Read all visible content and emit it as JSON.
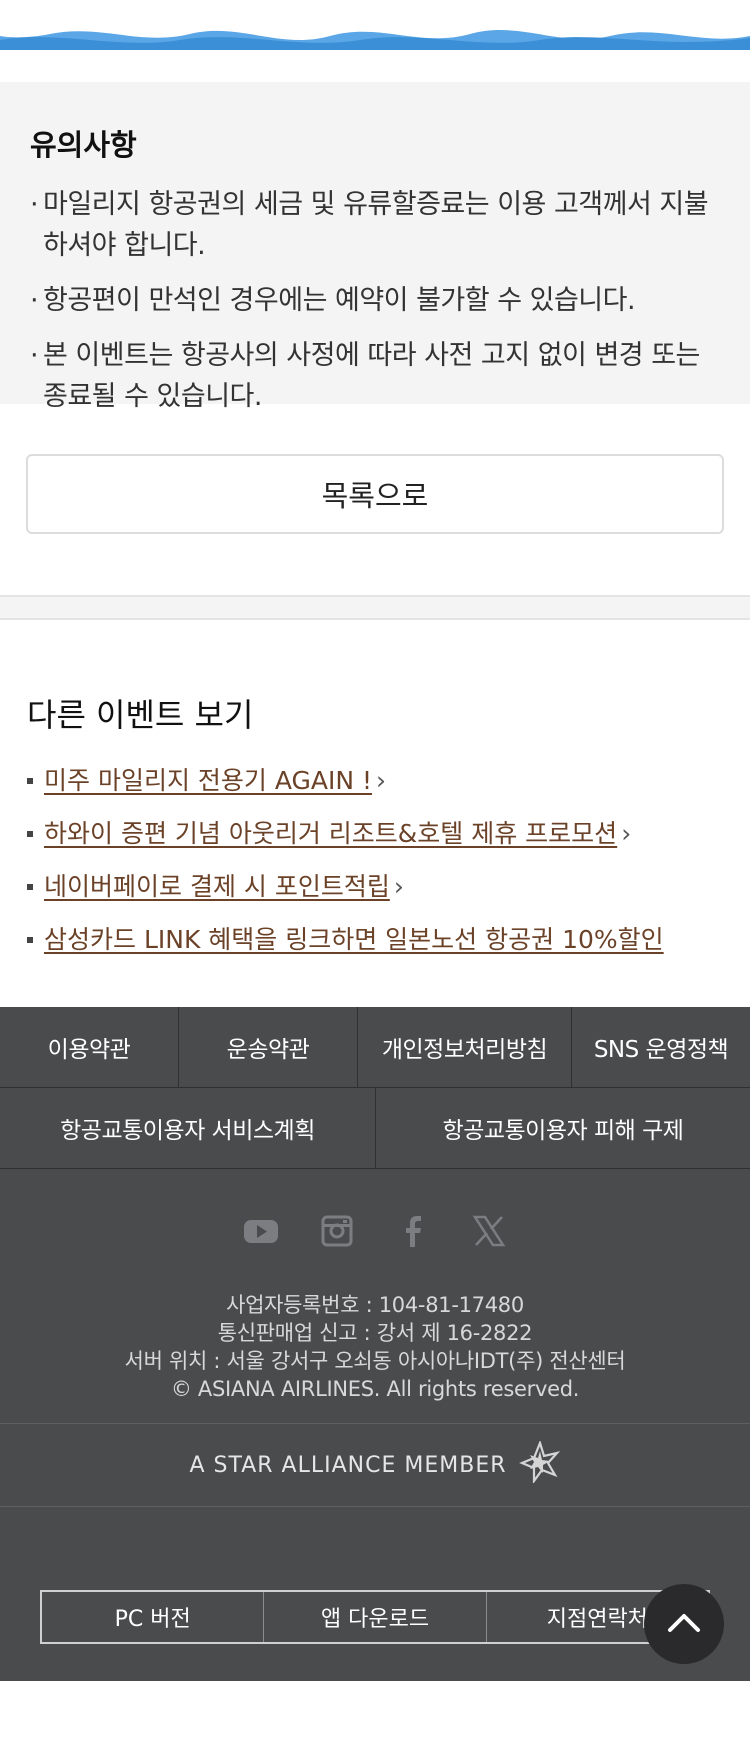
{
  "colors": {
    "accent_link": "#6b4228",
    "footer_bg": "#4a4b4d",
    "notice_bg": "#f4f4f4",
    "wave_blue": "#3a8fd6"
  },
  "notice": {
    "title": "유의사항",
    "items": [
      "마일리지 항공권의 세금 및 유류할증료는 이용 고객께서 지불하셔야 합니다.",
      "항공편이 만석인 경우에는 예약이 불가할 수 있습니다.",
      "본 이벤트는 항공사의 사정에 따라 사전 고지 없이 변경 또는 종료될 수 있습니다."
    ]
  },
  "list_button": "목록으로",
  "other_events": {
    "title": "다른 이벤트 보기",
    "items": [
      "미주 마일리지 전용기 AGAIN !",
      "하와이 증편 기념 아웃리거 리조트&호텔 제휴 프로모션",
      "네이버페이로 결제 시 포인트적립",
      "삼성카드 LINK 혜택을 링크하면 일본노선 항공권 10%할인"
    ],
    "chevron_icon": "chevron-right-icon"
  },
  "footer": {
    "links_row1": [
      "이용약관",
      "운송약관",
      "개인정보처리방침",
      "SNS 운영정책"
    ],
    "links_row2": [
      "항공교통이용자 서비스계획",
      "항공교통이용자 피해 구제"
    ],
    "social_icons": [
      "youtube-icon",
      "instagram-icon",
      "facebook-icon",
      "x-icon"
    ],
    "info_lines": [
      "사업자등록번호 : 104-81-17480",
      "통신판매업 신고 : 강서 제 16-2822",
      "서버 위치 : 서울 강서구 오쇠동 아시아나IDT(주) 전산센터",
      "© ASIANA AIRLINES. All rights reserved."
    ],
    "star_alliance": "A STAR ALLIANCE MEMBER",
    "bottom_links": [
      "PC 버전",
      "앱 다운로드",
      "지점연락처"
    ],
    "top_button_icon": "chevron-up-icon"
  }
}
